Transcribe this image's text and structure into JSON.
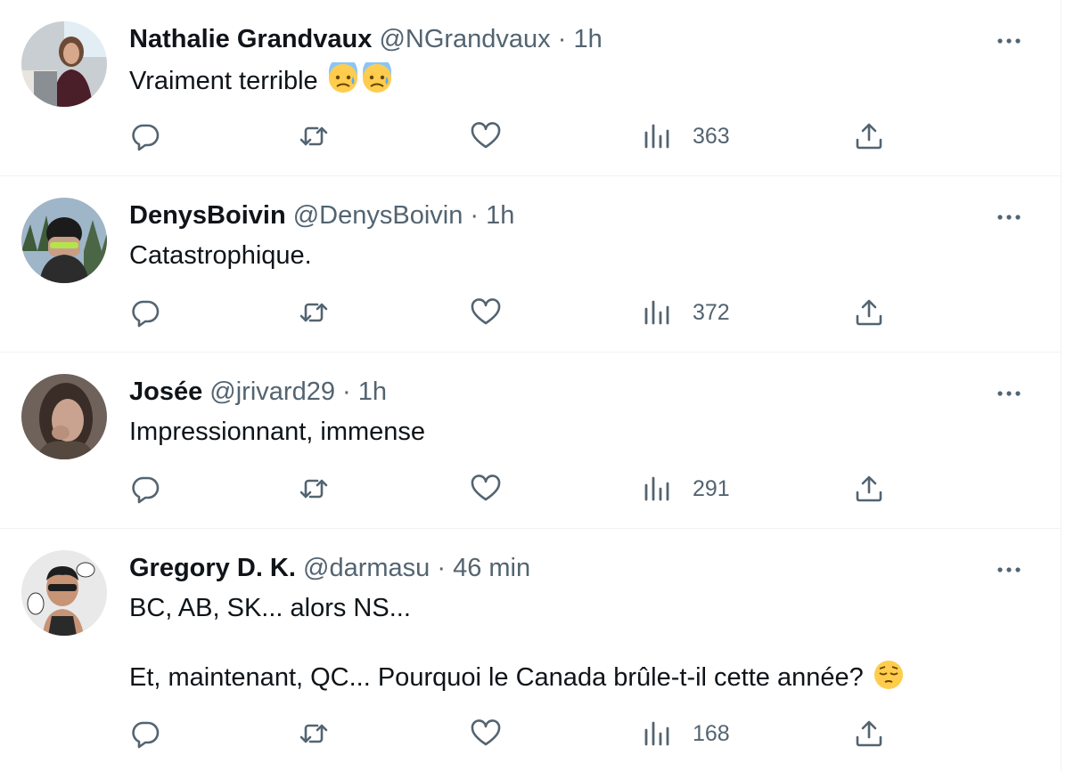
{
  "tweets": [
    {
      "name": "Nathalie Grandvaux",
      "handle": "@NGrandvaux",
      "dot": "·",
      "time": "1h",
      "text": "Vraiment terrible",
      "emoji": [
        "anxious-face-with-sweat",
        "anxious-face-with-sweat"
      ],
      "views": "363",
      "avatar_colors": {
        "bg": "#c9ced2",
        "skin": "#d7a88c",
        "hair": "#6b4a36",
        "clothes": "#4a1f2a"
      }
    },
    {
      "name": "DenysBoivin",
      "handle": "@DenysBoivin",
      "dot": "·",
      "time": "1h",
      "text": "Catastrophique.",
      "emoji": [],
      "views": "372",
      "avatar_colors": {
        "bg": "#9fb5c8",
        "skin": "#c89e86",
        "hair": "#1b1b1b",
        "clothes": "#2c2c2c"
      }
    },
    {
      "name": "Josée",
      "handle": "@jrivard29",
      "dot": "·",
      "time": "1h",
      "text": "Impressionnant, immense",
      "emoji": [],
      "views": "291",
      "avatar_colors": {
        "bg": "#6e625a",
        "skin": "#c9a38f",
        "hair": "#3a2d27",
        "clothes": "#55483f"
      }
    },
    {
      "name": "Gregory D. K.",
      "handle": "@darmasu",
      "dot": "·",
      "time": "46 min",
      "text_line1": "BC, AB, SK... alors NS...",
      "text_line2": "Et, maintenant, QC... Pourquoi le Canada brûle-t-il cette année?",
      "emoji": [
        "pensive-face"
      ],
      "views": "168",
      "avatar_colors": {
        "bg": "#e9e9e9",
        "skin": "#c79476",
        "hair": "#1e1e1e",
        "clothes": "#2a2a2a"
      }
    }
  ],
  "icons": {
    "reply": "reply-icon",
    "retweet": "retweet-icon",
    "like": "like-icon",
    "views": "views-icon",
    "share": "share-icon",
    "more": "more-icon"
  },
  "colors": {
    "text": "#0f1419",
    "secondary": "#536471",
    "border": "#eff3f4"
  }
}
